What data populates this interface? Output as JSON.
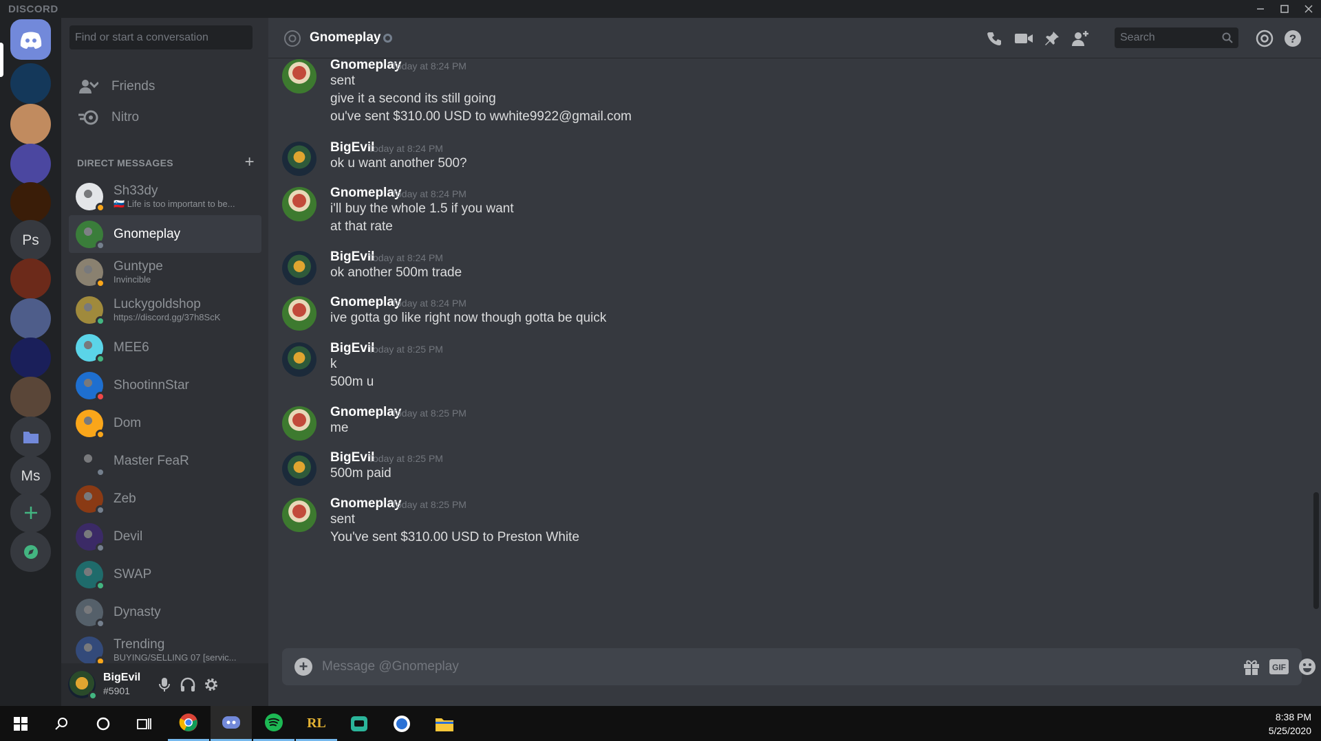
{
  "titlebar": {
    "brand": "DISCORD"
  },
  "guilds": {
    "items": [
      {
        "name": "home",
        "color": "#7289da",
        "label": ""
      },
      {
        "name": "lucky",
        "color": "#14385a",
        "label": ""
      },
      {
        "name": "avatar-guy",
        "color": "#c18b5f",
        "label": ""
      },
      {
        "name": "purple-monster",
        "color": "#4b47a0",
        "label": ""
      },
      {
        "name": "b-server",
        "color": "#3a1d08",
        "label": ""
      },
      {
        "name": "ps",
        "color": "#36393f",
        "label": "Ps"
      },
      {
        "name": "sr",
        "color": "#6c2a1a",
        "label": ""
      },
      {
        "name": "wolf",
        "color": "#4e5d8a",
        "label": ""
      },
      {
        "name": "dark-blue",
        "color": "#1a1f5a",
        "label": ""
      },
      {
        "name": "face",
        "color": "#5a4638",
        "label": ""
      },
      {
        "name": "folder",
        "color": "#36393f",
        "label": ""
      },
      {
        "name": "ms",
        "color": "#36393f",
        "label": "Ms"
      }
    ]
  },
  "sidebar": {
    "search_placeholder": "Find or start a conversation",
    "friends_label": "Friends",
    "nitro_label": "Nitro",
    "dm_header": "DIRECT MESSAGES",
    "dms": [
      {
        "name": "Sh33dy",
        "sub": "🇸🇮 Life is too important to be...",
        "color": "#e3e5e8",
        "status": "#faa61a"
      },
      {
        "name": "Gnomeplay",
        "sub": "",
        "color": "#3a7d3a",
        "status": "#747f8d"
      },
      {
        "name": "Guntype",
        "sub": "Invincible",
        "color": "#8a8170",
        "status": "#faa61a"
      },
      {
        "name": "Luckygoldshop",
        "sub": "https://discord.gg/37h8ScK",
        "color": "#a08a3c",
        "status": "#43b581"
      },
      {
        "name": "MEE6",
        "sub": "",
        "color": "#5bd4e8",
        "status": "#43b581"
      },
      {
        "name": "ShootinnStar",
        "sub": "",
        "color": "#1e6fd0",
        "status": "#f04747"
      },
      {
        "name": "Dom",
        "sub": "",
        "color": "#faa61a",
        "status": "#faa61a"
      },
      {
        "name": "Master FeaR",
        "sub": "",
        "color": "#2f3136",
        "status": "#747f8d"
      },
      {
        "name": "Zeb",
        "sub": "",
        "color": "#8a3a14",
        "status": "#747f8d"
      },
      {
        "name": "Devil",
        "sub": "",
        "color": "#3b2a66",
        "status": "#747f8d"
      },
      {
        "name": "SWAP",
        "sub": "",
        "color": "#1f6b6b",
        "status": "#43b581"
      },
      {
        "name": "Dynasty",
        "sub": "",
        "color": "#55606a",
        "status": "#747f8d"
      },
      {
        "name": "Trending",
        "sub": "BUYING/SELLING 07 [servic...",
        "color": "#334a7a",
        "status": "#faa61a"
      }
    ]
  },
  "user": {
    "name": "BigEvil",
    "tag": "#5901",
    "status": "#43b581"
  },
  "chat": {
    "channel": "Gnomeplay",
    "search_placeholder": "Search",
    "composer_placeholder": "Message @Gnomeplay",
    "groups": [
      {
        "author": "Gnomeplay",
        "time": "Today at 8:24 PM",
        "lines": [
          "sent",
          "give it a second its still going",
          "ou've sent $310.00 USD to wwhite9922@gmail.com"
        ]
      },
      {
        "author": "BigEvil",
        "time": "Today at 8:24 PM",
        "lines": [
          "ok u want another 500?"
        ]
      },
      {
        "author": "Gnomeplay",
        "time": "Today at 8:24 PM",
        "lines": [
          "i'll buy the whole 1.5 if you want",
          "at that rate"
        ]
      },
      {
        "author": "BigEvil",
        "time": "Today at 8:24 PM",
        "lines": [
          "ok another 500m trade"
        ]
      },
      {
        "author": "Gnomeplay",
        "time": "Today at 8:24 PM",
        "lines": [
          "ive gotta go like right now though gotta be quick"
        ]
      },
      {
        "author": "BigEvil",
        "time": "Today at 8:25 PM",
        "lines": [
          "k",
          "500m u"
        ]
      },
      {
        "author": "Gnomeplay",
        "time": "Today at 8:25 PM",
        "lines": [
          "me"
        ]
      },
      {
        "author": "BigEvil",
        "time": "Today at 8:25 PM",
        "lines": [
          "500m paid"
        ]
      },
      {
        "author": "Gnomeplay",
        "time": "Today at 8:25 PM",
        "lines": [
          "sent",
          "You've sent $310.00 USD to Preston White"
        ]
      }
    ]
  },
  "taskbar": {
    "time": "8:38 PM",
    "date": "5/25/2020"
  },
  "colors": {
    "gnome_av": "#3d7a2f",
    "bigevil_av": "#1b2a3a"
  }
}
